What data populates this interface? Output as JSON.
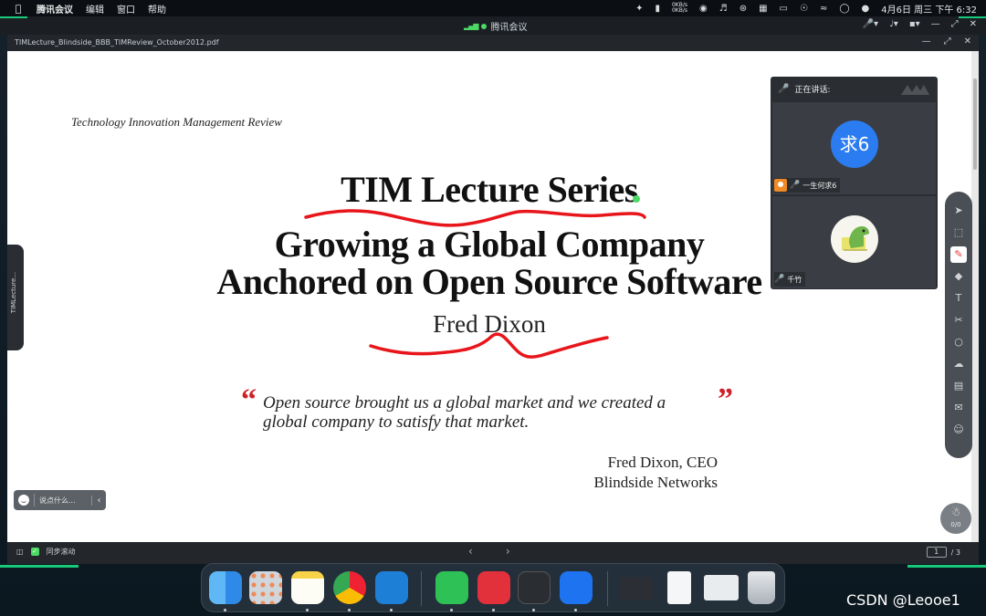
{
  "menubar": {
    "app_name": "腾讯会议",
    "menus": [
      "编辑",
      "窗口",
      "帮助"
    ],
    "net_up": "0KB/s",
    "net_down": "0KB/s",
    "datetime": "4月6日 周三 下午 6:32"
  },
  "meeting_window": {
    "title": "腾讯会议"
  },
  "document": {
    "filename": "TIMLecture_Blindside_BBB_TIMReview_October2012.pdf"
  },
  "slide": {
    "magazine": "Technology Innovation Management Review",
    "series_title": "TIM Lecture Series",
    "subtitle_line1": "Growing a Global Company",
    "subtitle_line2": "Anchored on Open Source Software",
    "speaker": "Fred Dixon",
    "quote_open": "“",
    "quote_line1": "Open source brought us a global market and we created a",
    "quote_line2": "global company to satisfy that market.",
    "quote_close": "”",
    "attribution_line1": "Fred Dixon, CEO",
    "attribution_line2": "Blindside Networks",
    "ink_color": "#e8151b"
  },
  "left_drawer": {
    "label": "TIMLecture..."
  },
  "chat": {
    "placeholder": "说点什么..."
  },
  "speaker_panel": {
    "header": "正在讲话:",
    "participants": [
      {
        "avatar_text": "求6",
        "name": "一生何求6",
        "avatar_color": "#2b7cf0",
        "is_host": true
      },
      {
        "avatar_text": "",
        "name": "千竹",
        "avatar_color": "#f6f6ee",
        "is_host": false
      }
    ]
  },
  "toolbar": {
    "tools": [
      "select-icon",
      "area-select-icon",
      "pen-icon",
      "eraser-icon",
      "text-icon",
      "scissors-icon",
      "shape-icon",
      "cloud-icon",
      "toolbox-icon",
      "comment-icon",
      "members-icon"
    ],
    "active_tool": "pen-icon",
    "page_counter": "0/0"
  },
  "bottom_bar": {
    "sync_scroll_label": "同步滚动",
    "sync_scroll_checked": true,
    "current_page": "1",
    "total_pages": "/ 3"
  },
  "dock": {
    "apps": [
      "finder-icon",
      "launchpad-icon",
      "notes-icon",
      "chrome-icon",
      "vscode-icon",
      "wechat-icon",
      "app-red-icon",
      "feishu-icon",
      "tencent-meeting-icon",
      "window-thumbnail-1",
      "window-thumbnail-2",
      "window-thumbnail-3",
      "trash-icon"
    ]
  },
  "watermark": "CSDN @Leooe1"
}
